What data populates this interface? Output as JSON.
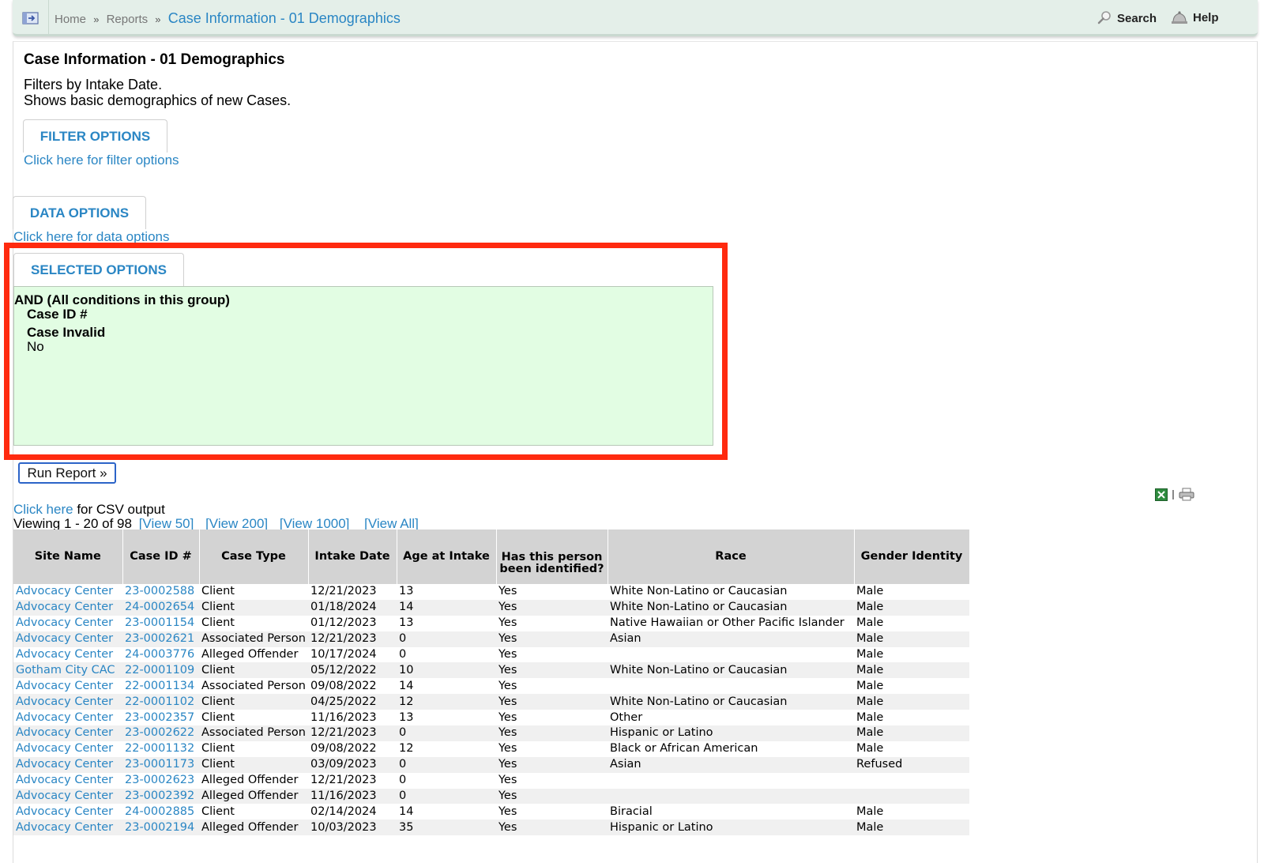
{
  "breadcrumb": {
    "home": "Home",
    "reports": "Reports",
    "sep": "»",
    "current": "Case Information - 01 Demographics"
  },
  "toolbar": {
    "search": "Search",
    "help": "Help"
  },
  "page": {
    "title": "Case Information - 01 Demographics",
    "desc_line1": "Filters by Intake Date.",
    "desc_line2": "Shows basic demographics of new Cases."
  },
  "filter_options": {
    "tab": "FILTER OPTIONS",
    "link": "Click here for filter options"
  },
  "data_options": {
    "tab": "DATA OPTIONS",
    "link": "Click here for data options"
  },
  "selected_options": {
    "tab": "SELECTED OPTIONS",
    "group": "AND (All conditions in this group)",
    "cond1_label": "Case ID #",
    "cond2_label": "Case Invalid",
    "cond2_value": "No"
  },
  "run_button": "Run Report »",
  "csv": {
    "link": "Click here",
    "text": " for CSV output"
  },
  "viewing": {
    "text": "Viewing 1 - 20 of 98",
    "view50": "[View 50]",
    "view200": "[View 200]",
    "view1000": "[View 1000]",
    "viewall": "[View All]"
  },
  "icons": {
    "excel": "excel-icon",
    "print": "printer-icon",
    "search": "magnifier-icon",
    "help": "help-bell-icon",
    "home": "home-arrow-icon"
  },
  "colors": {
    "link": "#2a86c4",
    "highlight": "#ff2a0f",
    "selected_bg": "#e2fde3",
    "header_bg": "#d3d3d3"
  },
  "table": {
    "headers": [
      "Site Name",
      "Case ID #",
      "Case Type",
      "Intake Date",
      "Age at Intake",
      "Has this person been identified?",
      "Race",
      "Gender Identity"
    ],
    "rows": [
      [
        "Advocacy Center",
        "23-0002588",
        "Client",
        "12/21/2023",
        "13",
        "Yes",
        "White Non-Latino or Caucasian",
        "Male"
      ],
      [
        "Advocacy Center",
        "24-0002654",
        "Client",
        "01/18/2024",
        "14",
        "Yes",
        "White Non-Latino or Caucasian",
        "Male"
      ],
      [
        "Advocacy Center",
        "23-0001154",
        "Client",
        "01/12/2023",
        "13",
        "Yes",
        "Native Hawaiian or Other Pacific Islander",
        "Male"
      ],
      [
        "Advocacy Center",
        "23-0002621",
        "Associated Person",
        "12/21/2023",
        "0",
        "Yes",
        "Asian",
        "Male"
      ],
      [
        "Advocacy Center",
        "24-0003776",
        "Alleged Offender",
        "10/17/2024",
        "0",
        "Yes",
        "",
        "Male"
      ],
      [
        "Gotham City CAC",
        "22-0001109",
        "Client",
        "05/12/2022",
        "10",
        "Yes",
        "White Non-Latino or Caucasian",
        "Male"
      ],
      [
        "Advocacy Center",
        "22-0001134",
        "Associated Person",
        "09/08/2022",
        "14",
        "Yes",
        "",
        "Male"
      ],
      [
        "Advocacy Center",
        "22-0001102",
        "Client",
        "04/25/2022",
        "12",
        "Yes",
        "White Non-Latino or Caucasian",
        "Male"
      ],
      [
        "Advocacy Center",
        "23-0002357",
        "Client",
        "11/16/2023",
        "13",
        "Yes",
        "Other",
        "Male"
      ],
      [
        "Advocacy Center",
        "23-0002622",
        "Associated Person",
        "12/21/2023",
        "0",
        "Yes",
        "Hispanic or Latino",
        "Male"
      ],
      [
        "Advocacy Center",
        "22-0001132",
        "Client",
        "09/08/2022",
        "12",
        "Yes",
        "Black or African American",
        "Male"
      ],
      [
        "Advocacy Center",
        "23-0001173",
        "Client",
        "03/09/2023",
        "0",
        "Yes",
        "Asian",
        "Refused"
      ],
      [
        "Advocacy Center",
        "23-0002623",
        "Alleged Offender",
        "12/21/2023",
        "0",
        "Yes",
        "",
        ""
      ],
      [
        "Advocacy Center",
        "23-0002392",
        "Alleged Offender",
        "11/16/2023",
        "0",
        "Yes",
        "",
        ""
      ],
      [
        "Advocacy Center",
        "24-0002885",
        "Client",
        "02/14/2024",
        "14",
        "Yes",
        "Biracial",
        "Male"
      ],
      [
        "Advocacy Center",
        "23-0002194",
        "Alleged Offender",
        "10/03/2023",
        "35",
        "Yes",
        "Hispanic or Latino",
        "Male"
      ]
    ]
  }
}
